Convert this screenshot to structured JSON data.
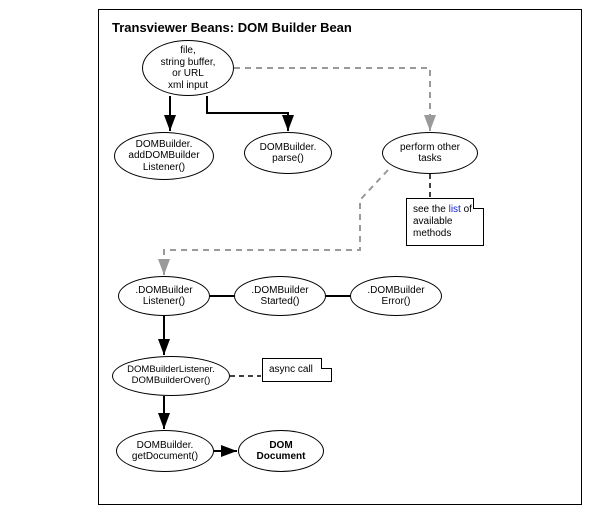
{
  "title": "Transviewer Beans: DOM Builder Bean",
  "nodes": {
    "input": "file,\nstring buffer,\nor URL\nxml input",
    "addListener": "DOMBuilder.\naddDOMBuilder\nListener()",
    "parse": "DOMBuilder.\nparse()",
    "otherTasks": "perform other\ntasks",
    "listener": ".DOMBuilder\nListener()",
    "started": ".DOMBuilder\nStarted()",
    "error": ".DOMBuilder\nError()",
    "listenerOver": "DOMBuilderListener.\nDOMBuilderOver()",
    "getDocument": "DOMBuilder.\ngetDocument()",
    "domDoc": "DOM\nDocument"
  },
  "notes": {
    "methodsNote_pre": "see the ",
    "methodsNote_link": "list",
    "methodsNote_post": " of\navailable\nmethods",
    "asyncCall": "async call"
  }
}
